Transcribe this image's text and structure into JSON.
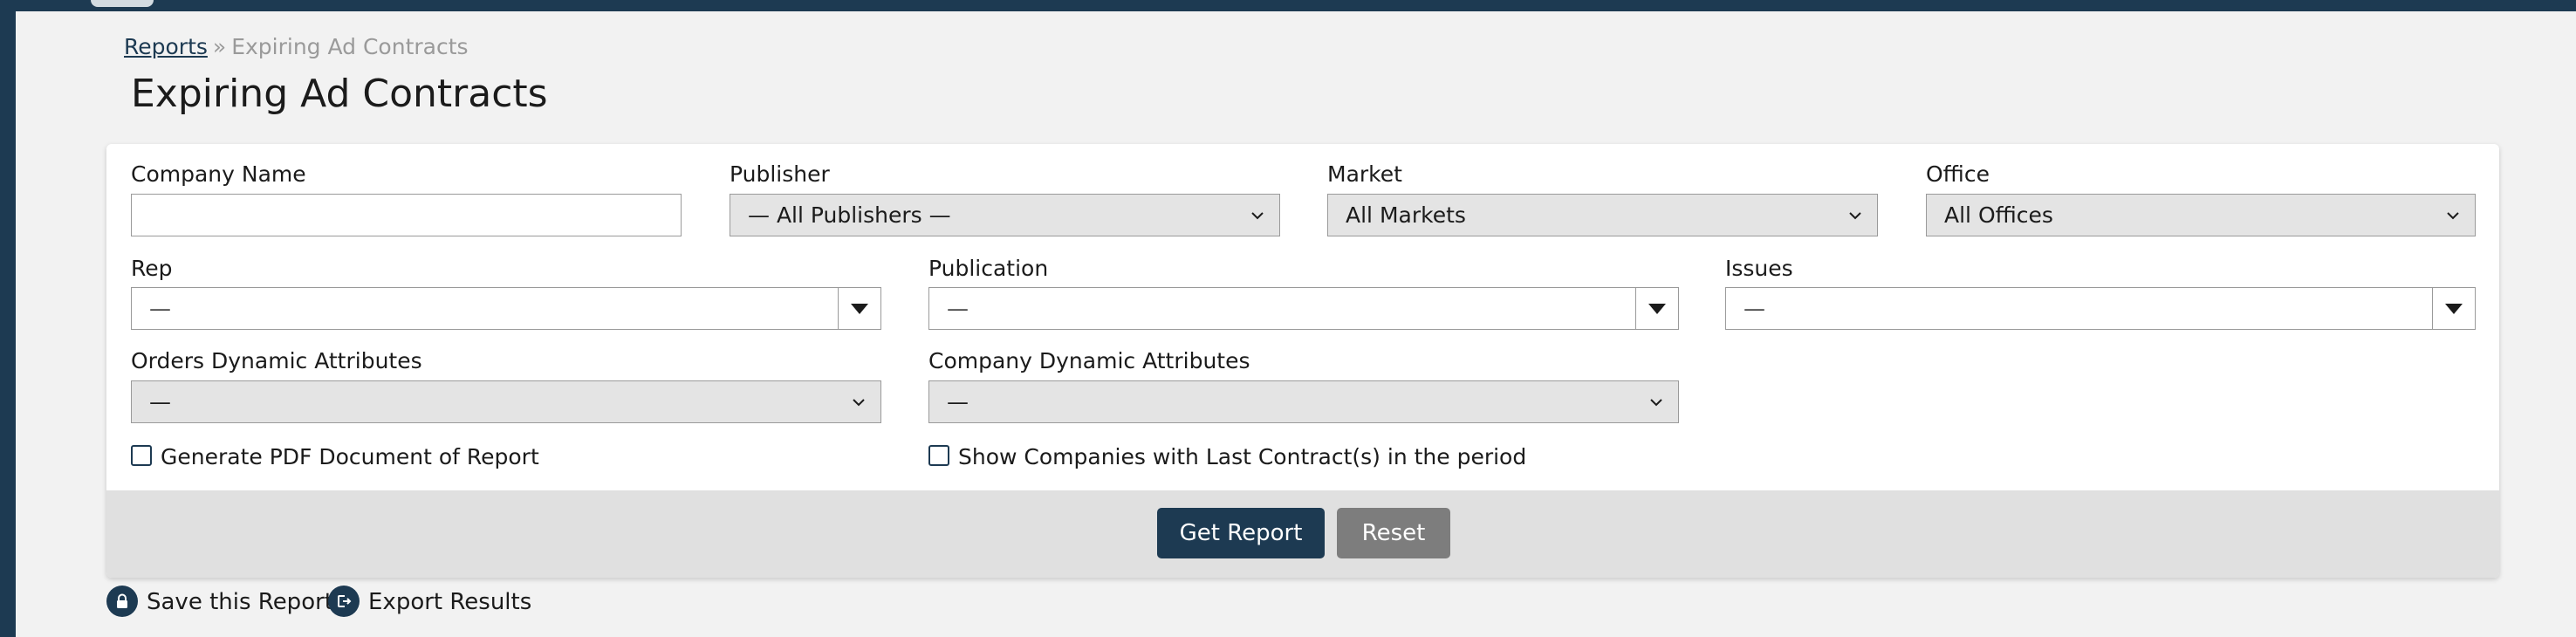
{
  "breadcrumb": {
    "parent": "Reports",
    "separator": "»",
    "current": "Expiring Ad Contracts"
  },
  "page": {
    "title": "Expiring Ad Contracts"
  },
  "filters": {
    "company_name": {
      "label": "Company Name",
      "value": "",
      "placeholder": ""
    },
    "publisher": {
      "label": "Publisher",
      "selected": "— All Publishers —"
    },
    "market": {
      "label": "Market",
      "selected": "All Markets"
    },
    "office": {
      "label": "Office",
      "selected": "All Offices"
    },
    "rep": {
      "label": "Rep",
      "selected": "—"
    },
    "publication": {
      "label": "Publication",
      "selected": "—"
    },
    "issues": {
      "label": "Issues",
      "selected": "—"
    },
    "orders_dynamic_attributes": {
      "label": "Orders Dynamic Attributes",
      "selected": "—"
    },
    "company_dynamic_attributes": {
      "label": "Company Dynamic Attributes",
      "selected": "—"
    }
  },
  "options": {
    "generate_pdf": {
      "label": "Generate PDF Document of Report",
      "checked": false
    },
    "show_last_contracts": {
      "label": "Show Companies with Last Contract(s) in the period",
      "checked": false
    }
  },
  "actions": {
    "get_report": "Get Report",
    "reset": "Reset"
  },
  "bottom_links": {
    "save_report": "Save this Report",
    "export_results": "Export Results"
  },
  "colors": {
    "primary": "#1d3a52",
    "secondary_button": "#7d7d7d",
    "footer_bg": "#e0e0e0",
    "page_bg": "#f2f2f2"
  },
  "icons": {
    "select": "chevron-down-icon",
    "combo": "triangle-down-icon",
    "save": "lock-icon",
    "export": "export-icon"
  }
}
